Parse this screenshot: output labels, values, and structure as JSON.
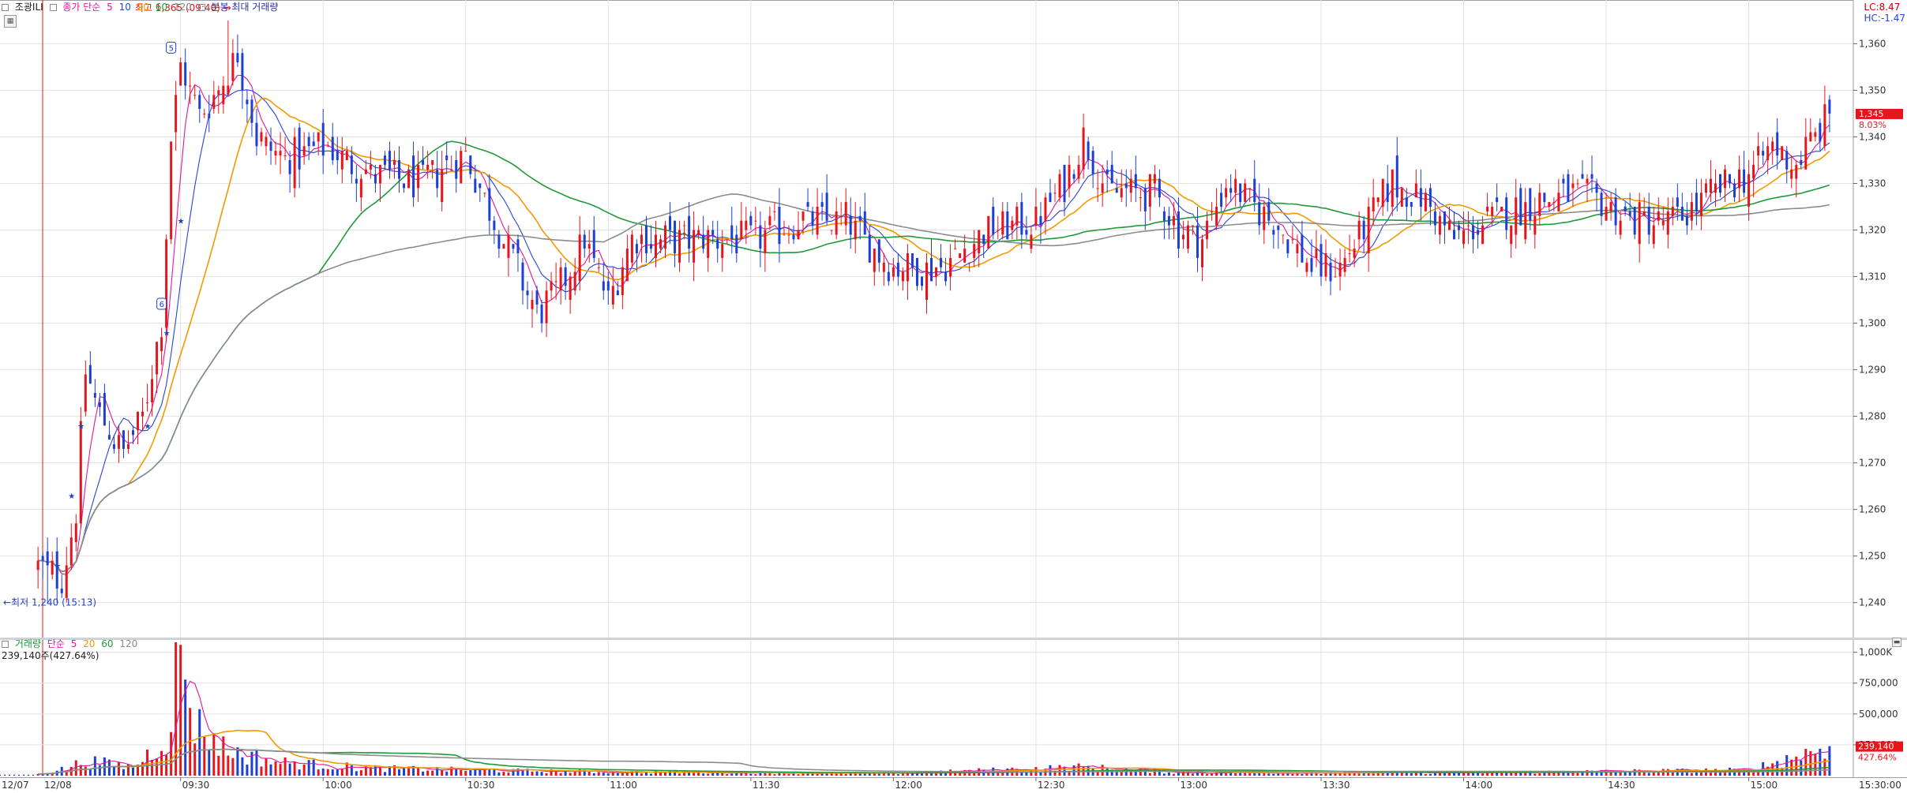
{
  "header": {
    "stock_name": "조광ILI",
    "price_legend_prefix": "종가 단순",
    "ma_periods": [
      "5",
      "10",
      "20",
      "60",
      "120"
    ],
    "ma_colors": [
      "#e0189a",
      "#2b44d6",
      "#f29a00",
      "#1f9a3a",
      "#8c8c8c"
    ],
    "max_volume_label": "분봉 최대 거래량",
    "lc_label": "LC:8.47",
    "hc_label": "HC:-1.47"
  },
  "volume_panel": {
    "legend_title": "거래량",
    "legend_prefix": "단순",
    "ma_periods": [
      "5",
      "20",
      "60",
      "120"
    ],
    "ma_colors": [
      "#e0189a",
      "#f29a00",
      "#1f9a3a",
      "#8c8c8c"
    ],
    "current_value_text": "239,140주(427.64%)",
    "last_volume_tag": "239,140",
    "last_volume_pct_tag": "427.64%"
  },
  "annotations": {
    "high_label": "최고 1,365 (09:40)",
    "low_label": "최저 1,240 (15:13)",
    "last_price_tag": "1,345",
    "last_change_tag": "8.03%",
    "marker_5": "5",
    "marker_6": "6"
  },
  "time_axis": {
    "left_dates": [
      "12/07",
      "12/08"
    ],
    "end_time": "15:30:00"
  },
  "colors": {
    "up": "#e8141b",
    "down": "#1c3fd6",
    "price_tag_bg": "#e8141b",
    "grid": "#e2e2e2"
  },
  "chart_data": [
    {
      "type": "bar",
      "title": "",
      "x_ticks": [
        "09:30",
        "10:00",
        "10:30",
        "11:00",
        "11:30",
        "12:00",
        "12:30",
        "13:00",
        "13:30",
        "14:00",
        "14:30",
        "15:00"
      ],
      "y_ticks": [
        1240,
        1250,
        1260,
        1270,
        1280,
        1290,
        1300,
        1310,
        1320,
        1330,
        1340,
        1350,
        1360
      ],
      "ylim": [
        1233,
        1366
      ],
      "x_range": [
        "09:00",
        "15:30"
      ],
      "high": {
        "value": 1365,
        "time": "09:40"
      },
      "low": {
        "value": 1240,
        "time": "15:13"
      },
      "last_price": 1345,
      "anchors": [
        {
          "t": "09:00",
          "close": 1248
        },
        {
          "t": "09:05",
          "close": 1245
        },
        {
          "t": "09:08",
          "close": 1260
        },
        {
          "t": "09:10",
          "close": 1290
        },
        {
          "t": "09:13",
          "close": 1280
        },
        {
          "t": "09:18",
          "close": 1272
        },
        {
          "t": "09:22",
          "close": 1280
        },
        {
          "t": "09:26",
          "close": 1300
        },
        {
          "t": "09:28",
          "close": 1340
        },
        {
          "t": "09:30",
          "close": 1355
        },
        {
          "t": "09:34",
          "close": 1345
        },
        {
          "t": "09:38",
          "close": 1350
        },
        {
          "t": "09:42",
          "close": 1358
        },
        {
          "t": "09:46",
          "close": 1340
        },
        {
          "t": "09:52",
          "close": 1335
        },
        {
          "t": "10:00",
          "close": 1338
        },
        {
          "t": "10:10",
          "close": 1332
        },
        {
          "t": "10:20",
          "close": 1330
        },
        {
          "t": "10:30",
          "close": 1336
        },
        {
          "t": "10:38",
          "close": 1318
        },
        {
          "t": "10:45",
          "close": 1302
        },
        {
          "t": "10:50",
          "close": 1308
        },
        {
          "t": "10:55",
          "close": 1318
        },
        {
          "t": "11:00",
          "close": 1305
        },
        {
          "t": "11:05",
          "close": 1318
        },
        {
          "t": "11:15",
          "close": 1318
        },
        {
          "t": "11:30",
          "close": 1318
        },
        {
          "t": "11:40",
          "close": 1322
        },
        {
          "t": "11:50",
          "close": 1322
        },
        {
          "t": "12:00",
          "close": 1312
        },
        {
          "t": "12:10",
          "close": 1312
        },
        {
          "t": "12:20",
          "close": 1320
        },
        {
          "t": "12:30",
          "close": 1322
        },
        {
          "t": "12:36",
          "close": 1330
        },
        {
          "t": "12:40",
          "close": 1340
        },
        {
          "t": "12:45",
          "close": 1328
        },
        {
          "t": "12:55",
          "close": 1328
        },
        {
          "t": "13:00",
          "close": 1320
        },
        {
          "t": "13:05",
          "close": 1318
        },
        {
          "t": "13:10",
          "close": 1330
        },
        {
          "t": "13:20",
          "close": 1322
        },
        {
          "t": "13:28",
          "close": 1312
        },
        {
          "t": "13:34",
          "close": 1312
        },
        {
          "t": "13:40",
          "close": 1322
        },
        {
          "t": "13:45",
          "close": 1330
        },
        {
          "t": "13:52",
          "close": 1326
        },
        {
          "t": "13:58",
          "close": 1318
        },
        {
          "t": "14:05",
          "close": 1322
        },
        {
          "t": "14:15",
          "close": 1326
        },
        {
          "t": "14:25",
          "close": 1328
        },
        {
          "t": "14:35",
          "close": 1322
        },
        {
          "t": "14:45",
          "close": 1322
        },
        {
          "t": "14:52",
          "close": 1328
        },
        {
          "t": "15:00",
          "close": 1332
        },
        {
          "t": "15:05",
          "close": 1338
        },
        {
          "t": "15:10",
          "close": 1334
        },
        {
          "t": "15:17",
          "close": 1345
        }
      ]
    },
    {
      "type": "bar",
      "title": "",
      "y_ticks": [
        250000,
        500000,
        750000,
        1000000
      ],
      "y_tick_labels": [
        "250,000",
        "500,000",
        "750,000",
        "1,000K"
      ],
      "ylim": [
        0,
        1100000
      ],
      "last_volume": 239140,
      "last_volume_pct": 427.64,
      "peak_volume": {
        "time": "09:30",
        "value": 1060000
      },
      "anchors": [
        {
          "t": "09:00",
          "v": 15000
        },
        {
          "t": "09:06",
          "v": 60000
        },
        {
          "t": "09:10",
          "v": 120000
        },
        {
          "t": "09:20",
          "v": 70000
        },
        {
          "t": "09:27",
          "v": 300000
        },
        {
          "t": "09:30",
          "v": 1060000
        },
        {
          "t": "09:33",
          "v": 420000
        },
        {
          "t": "09:40",
          "v": 200000
        },
        {
          "t": "09:50",
          "v": 110000
        },
        {
          "t": "10:10",
          "v": 60000
        },
        {
          "t": "10:40",
          "v": 40000
        },
        {
          "t": "11:00",
          "v": 30000
        },
        {
          "t": "12:00",
          "v": 18000
        },
        {
          "t": "12:40",
          "v": 70000
        },
        {
          "t": "13:00",
          "v": 25000
        },
        {
          "t": "14:00",
          "v": 25000
        },
        {
          "t": "15:00",
          "v": 45000
        },
        {
          "t": "15:17",
          "v": 239140
        }
      ]
    }
  ]
}
